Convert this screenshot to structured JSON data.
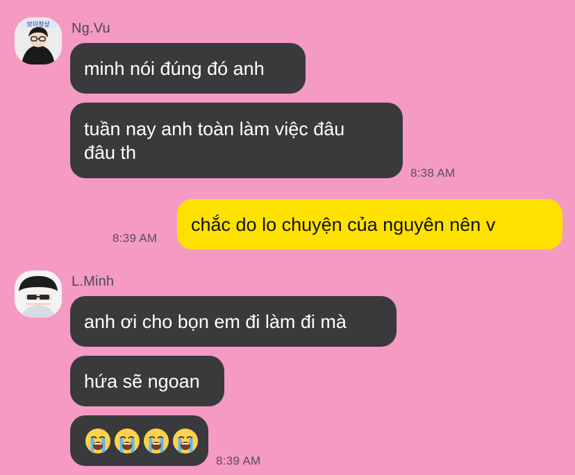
{
  "colors": {
    "background": "#f49ac3",
    "incoming_bubble": "#3a3a3c",
    "outgoing_bubble": "#ffe100",
    "timestamp": "#5f4a56"
  },
  "messages": {
    "ngvu": {
      "name": "Ng.Vu",
      "msg1": "minh nói đúng đó anh",
      "msg2_line1": "tuần nay anh toàn làm việc đâu",
      "msg2_line2": "đâu th",
      "time": "8:38 AM"
    },
    "me": {
      "text": "chắc do lo chuyện của nguyên nên v",
      "time": "8:39 AM"
    },
    "lminh": {
      "name": "L.Minh",
      "msg1": "anh ơi cho bọn em đi làm đi mà",
      "msg2": "hứa sẽ ngoan",
      "emoji_count": 4,
      "emoji_icon": "loudly-crying-face-icon",
      "time": "8:39 AM"
    }
  }
}
